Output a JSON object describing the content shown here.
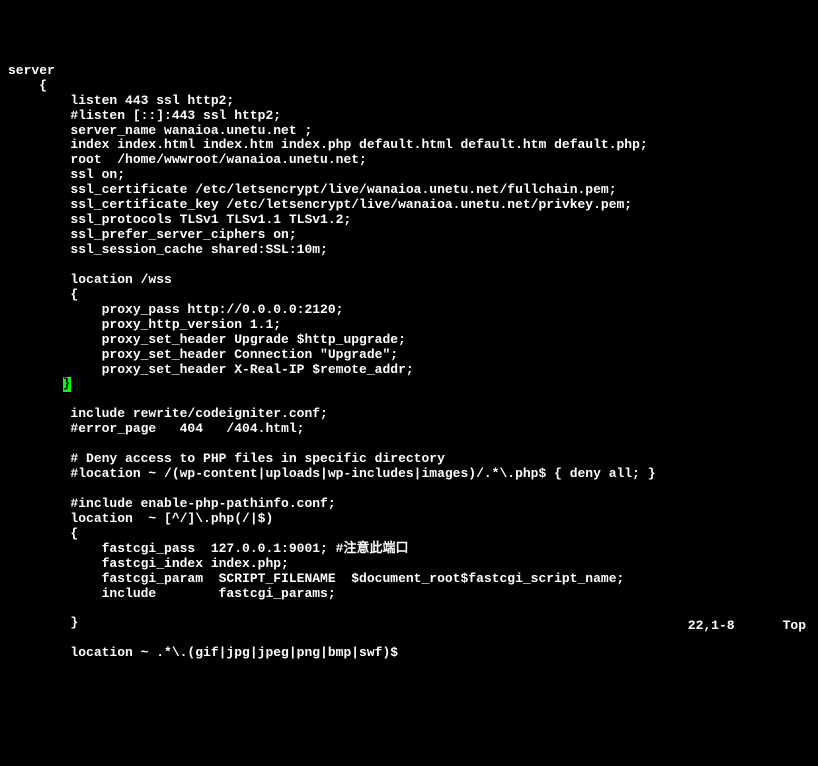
{
  "lines": [
    "server",
    "    {",
    "        listen 443 ssl http2;",
    "        #listen [::]:443 ssl http2;",
    "        server_name wanaioa.unetu.net ;",
    "        index index.html index.htm index.php default.html default.htm default.php;",
    "        root  /home/wwwroot/wanaioa.unetu.net;",
    "        ssl on;",
    "        ssl_certificate /etc/letsencrypt/live/wanaioa.unetu.net/fullchain.pem;",
    "        ssl_certificate_key /etc/letsencrypt/live/wanaioa.unetu.net/privkey.pem;",
    "        ssl_protocols TLSv1 TLSv1.1 TLSv1.2;",
    "        ssl_prefer_server_ciphers on;",
    "        ssl_session_cache shared:SSL:10m;",
    "",
    "        location /wss",
    "        {",
    "            proxy_pass http://0.0.0.0:2120;",
    "            proxy_http_version 1.1;",
    "            proxy_set_header Upgrade $http_upgrade;",
    "            proxy_set_header Connection \"Upgrade\";",
    "            proxy_set_header X-Real-IP $remote_addr;",
    "       ",
    "",
    "        include rewrite/codeigniter.conf;",
    "        #error_page   404   /404.html;",
    "",
    "        # Deny access to PHP files in specific directory",
    "        #location ~ /(wp-content|uploads|wp-includes|images)/.*\\.php$ { deny all; }",
    "",
    "        #include enable-php-pathinfo.conf;",
    "        location  ~ [^/]\\.php(/|$)",
    "        {",
    "            fastcgi_pass  127.0.0.1:9001; #注意此端口",
    "            fastcgi_index index.php;",
    "            fastcgi_param  SCRIPT_FILENAME  $document_root$fastcgi_script_name;",
    "            include        fastcgi_params;",
    "",
    "        }",
    "",
    "        location ~ .*\\.(gif|jpg|jpeg|png|bmp|swf)$"
  ],
  "cursor_line_index": 21,
  "cursor_char": "}",
  "status": {
    "position": "22,1-8",
    "scroll": "Top"
  }
}
